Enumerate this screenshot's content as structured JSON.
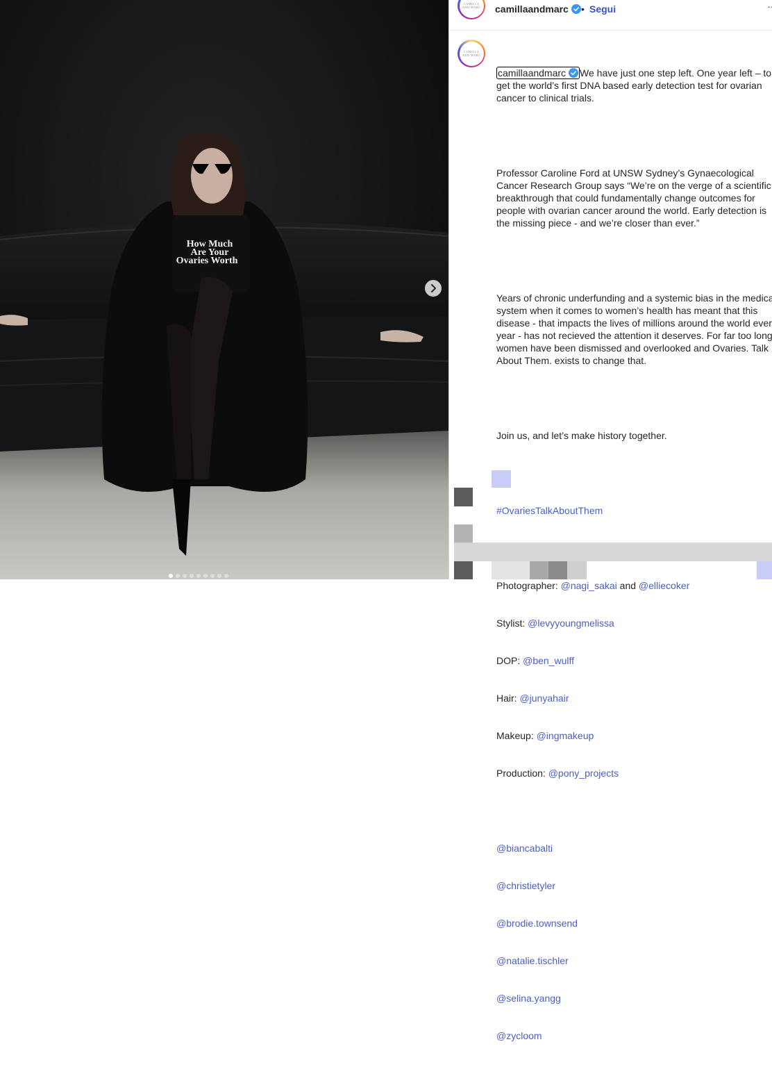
{
  "post": {
    "username": "camillaandmarc",
    "avatar_text": [
      "CAMILLA",
      "AND MARC"
    ],
    "header_separator": "•",
    "follow_label": "Segui",
    "more_icon": "…"
  },
  "media": {
    "shirt_text": [
      "How Much",
      "Are Your",
      "Ovaries Worth"
    ],
    "carousel_dots": 9,
    "active_dot": 0,
    "next_icon": "chevron-right"
  },
  "caption": {
    "first_line": "We have just one step left. One year left – to get the world’s first DNA based early detection test for ovarian cancer to clinical trials.",
    "p2": "Professor Caroline Ford at UNSW Sydney’s Gynaecological Cancer Research Group says “We’re on the verge of a scientific breakthrough that could fundamentally change outcomes for people with ovarian cancer around the world. Early detection is the missing piece - and we’re closer than ever.”",
    "p3": "Years of chronic underfunding and a systemic bias in the medical system when it comes to women’s health has meant that this disease - that impacts the lives of millions around the world every year - has not recieved the attention it deserves. For far too long women have been dismissed and overlooked and Ovaries. Talk About Them. exists to change that.",
    "p4": "Join us, and let’s make history together.",
    "hashtag": "#OvariesTalkAboutThem",
    "credits": {
      "photographer_label": "Photographer: ",
      "photographer_1": "@nagi_sakai",
      "and": " and ",
      "photographer_2": "@elliecoker",
      "stylist_label": "Stylist: ",
      "stylist": "@levyyoungmelissa",
      "dop_label": "DOP: ",
      "dop": "@ben_wulff",
      "hair_label": "Hair: ",
      "hair": "@junyahair",
      "makeup_label": "Makeup: ",
      "makeup": "@ingmakeup",
      "production_label": "Production: ",
      "production": "@pony_projects"
    },
    "tags": [
      "@biancabalti",
      "@christietyler",
      "@brodie.townsend",
      "@natalie.tischler",
      "@selina.yangg",
      "@zycloom"
    ]
  },
  "colors": {
    "link": "#4a5ec8",
    "follow": "#3850c9",
    "verified": "#3897f0"
  }
}
